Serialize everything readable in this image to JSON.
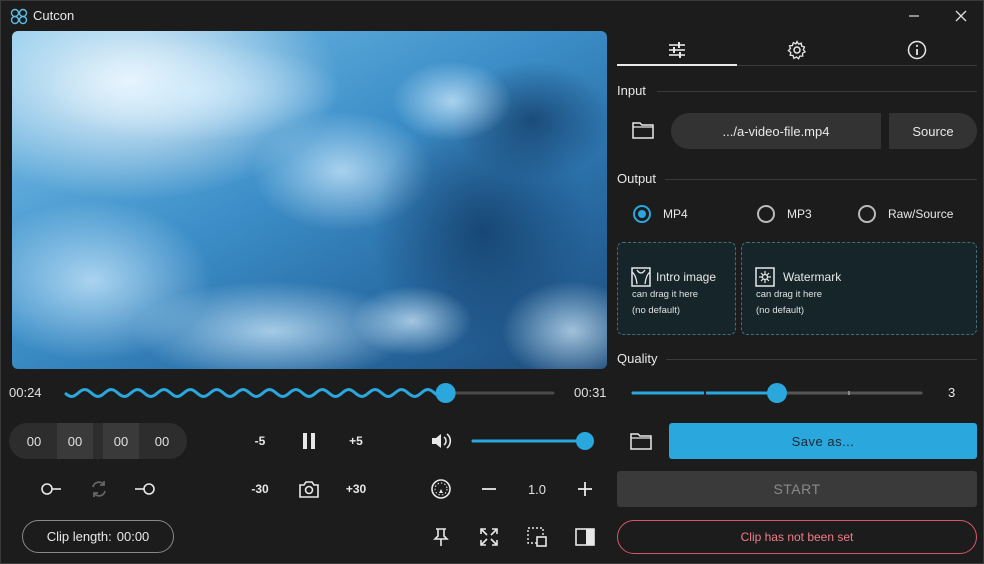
{
  "app": {
    "title": "Cutcon"
  },
  "player": {
    "current_time": "00:24",
    "total_time": "00:31",
    "progress": 0.78
  },
  "clip": {
    "start_min": "00",
    "start_sec": "00",
    "end_min": "00",
    "end_sec": "00",
    "length_label": "Clip length:",
    "length_value": "00:00"
  },
  "controls": {
    "back5": "-5",
    "fwd5": "+5",
    "back30": "-30",
    "fwd30": "+30",
    "volume": 1.0,
    "speed": "1.0"
  },
  "tabs": [
    {
      "icon": "sliders-icon",
      "active": true
    },
    {
      "icon": "gear-icon",
      "active": false
    },
    {
      "icon": "info-icon",
      "active": false
    }
  ],
  "input": {
    "section": "Input",
    "file": ".../a-video-file.mp4",
    "source_button": "Source"
  },
  "output": {
    "section": "Output",
    "formats": [
      "MP4",
      "MP3",
      "Raw/Source"
    ],
    "selected": "MP4"
  },
  "intro": {
    "title": "Intro image",
    "hint": "can drag it here",
    "default": "(no default)"
  },
  "watermark": {
    "title": "Watermark",
    "hint": "can drag it here",
    "default": "(no default)"
  },
  "quality": {
    "section": "Quality",
    "value": "3",
    "level": 0.5
  },
  "save": {
    "label": "Save as..."
  },
  "start": {
    "label": "START"
  },
  "status": {
    "text": "Clip has not been set"
  },
  "colors": {
    "accent": "#2aa7dd",
    "status_border": "#d9566a",
    "start_bg": "#3a3a3a"
  }
}
